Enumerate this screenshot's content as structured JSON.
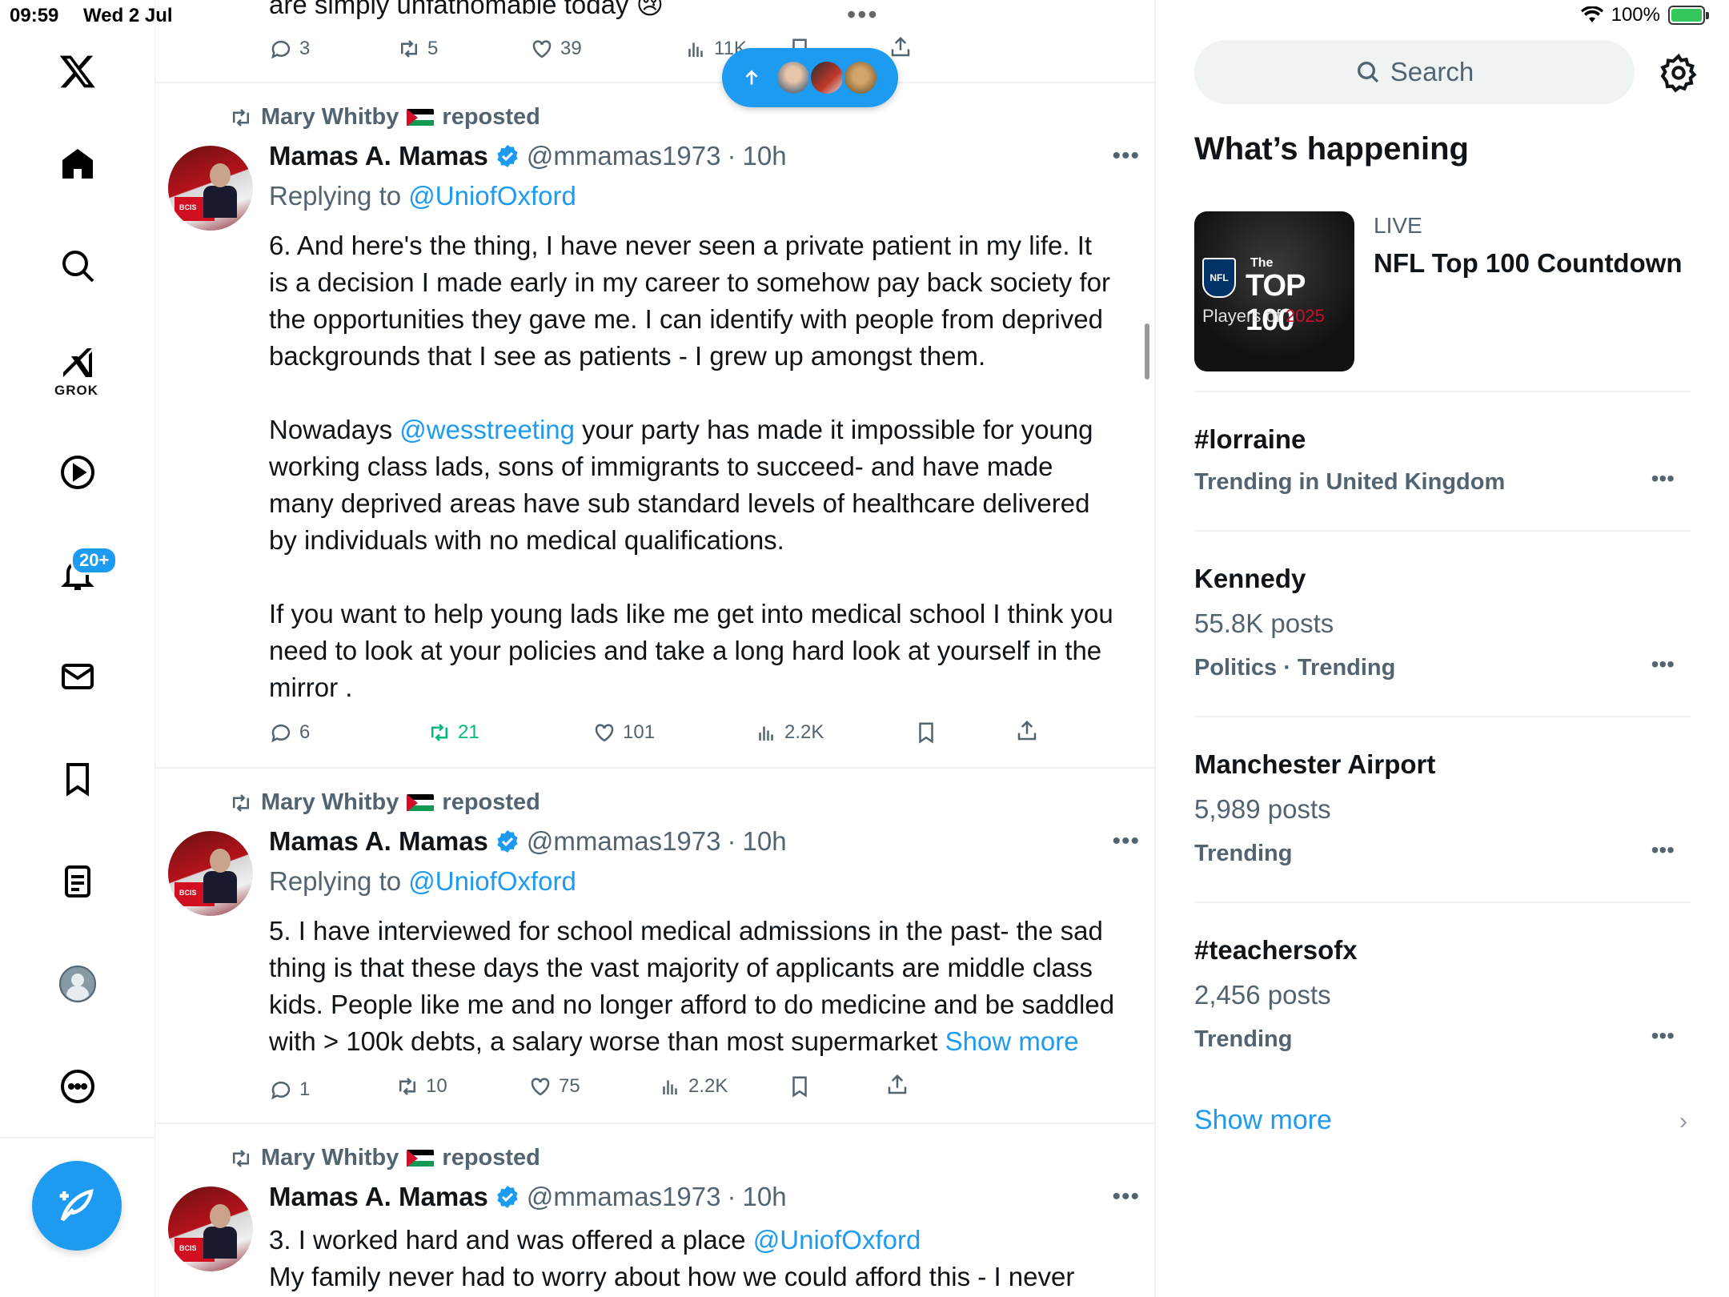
{
  "status_bar": {
    "time": "09:59",
    "date": "Wed 2 Jul",
    "battery": "100%"
  },
  "nav": {
    "items": [
      "x-logo",
      "home",
      "explore",
      "grok",
      "video",
      "notifications",
      "messages",
      "bookmarks",
      "lists",
      "profile",
      "more"
    ],
    "grok_label": "GROK",
    "notifications_badge": "20+"
  },
  "top_partial": {
    "text": "are simply unfathomable today 😢",
    "replies": "3",
    "reposts": "5",
    "likes": "39",
    "views": "11K"
  },
  "tweets": [
    {
      "reposted_by": "Mary Whitby",
      "reposted_label": "reposted",
      "name": "Mamas A. Mamas",
      "handle": "@mmamas1973",
      "time": "10h",
      "replying_label": "Replying to",
      "replying_to": "@UniofOxford",
      "p1": "6. And here's the thing, I have never seen a private patient in my life. It is a decision I made early in my career to somehow pay back society for the opportunities they gave me. I can identify with people from deprived backgrounds that I see as patients - I grew up amongst them.",
      "p2_pre": "Nowadays ",
      "p2_mention": "@wesstreeting",
      "p2_post": " your party has made it impossible for young working class lads, sons of immigrants to succeed- and have made many deprived areas have sub standard levels of healthcare delivered by individuals with no medical qualifications.",
      "p3": "If you want to help young lads like me get into medical school I think you need to look at your policies and take a long hard look at yourself in the mirror .",
      "replies": "6",
      "reposts": "21",
      "likes": "101",
      "views": "2.2K"
    },
    {
      "reposted_by": "Mary Whitby",
      "reposted_label": "reposted",
      "name": "Mamas A. Mamas",
      "handle": "@mmamas1973",
      "time": "10h",
      "replying_label": "Replying to",
      "replying_to": "@UniofOxford",
      "p1": "5. I have interviewed for school medical admissions in the past- the sad thing is that these days the vast majority of applicants are middle class kids. People like me and no longer afford to do medicine and be saddled with > 100k debts, a salary worse than most supermarket ",
      "show_more": "Show more",
      "replies": "1",
      "reposts": "10",
      "likes": "75",
      "views": "2.2K"
    },
    {
      "reposted_by": "Mary Whitby",
      "reposted_label": "reposted",
      "name": "Mamas A. Mamas",
      "handle": "@mmamas1973",
      "time": "10h",
      "line1_pre": "3. I worked hard and was offered a place ",
      "line1_mention": "@UniofOxford",
      "line2": "My family never had to worry about how we could afford this - I never"
    }
  ],
  "right": {
    "search_placeholder": "Search",
    "heading": "What’s happening",
    "live": {
      "label": "LIVE",
      "title": "NFL Top 100 Countdown",
      "img_the": "The",
      "img_top": "TOP 100",
      "img_players": "Players of",
      "img_year": "2025",
      "img_nfl": "NFL"
    },
    "trends": [
      {
        "title": "#lorraine",
        "posts": "",
        "meta": "Trending in United Kingdom"
      },
      {
        "title": "Kennedy",
        "posts": "55.8K posts",
        "meta": "Politics · Trending"
      },
      {
        "title": "Manchester Airport",
        "posts": "5,989 posts",
        "meta": "Trending"
      },
      {
        "title": "#teachersofx",
        "posts": "2,456 posts",
        "meta": "Trending"
      }
    ],
    "show_more": "Show more"
  },
  "colors": {
    "accent": "#1d9bf0",
    "repost_active": "#00ba7c",
    "muted": "#536471"
  }
}
